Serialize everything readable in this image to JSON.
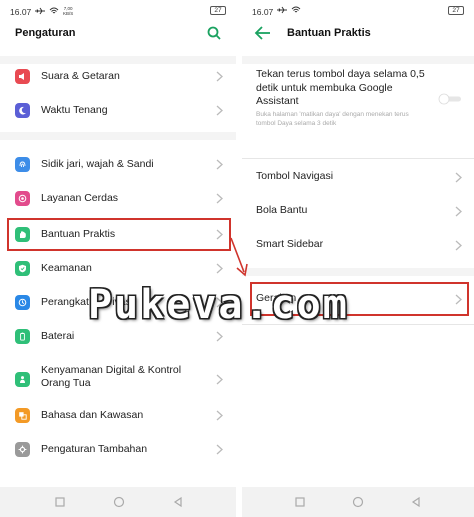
{
  "left": {
    "status": {
      "time": "16.07",
      "speed": "7,00\nKB/S",
      "battery": "27"
    },
    "title": "Pengaturan",
    "sections": [
      [
        {
          "id": "sound",
          "label": "Suara & Getaran",
          "icon": "speaker-icon",
          "color": "#e84a52"
        },
        {
          "id": "quiet",
          "label": "Waktu Tenang",
          "icon": "moon-icon",
          "color": "#5b5fd6"
        }
      ],
      [
        {
          "id": "fingerprint",
          "label": "Sidik jari, wajah & Sandi",
          "icon": "fingerprint-icon",
          "color": "#3d8de8"
        },
        {
          "id": "smart",
          "label": "Layanan Cerdas",
          "icon": "smart-services-icon",
          "color": "#e24b8c"
        },
        {
          "id": "assist",
          "label": "Bantuan Praktis",
          "icon": "hand-icon",
          "color": "#2fbf78"
        },
        {
          "id": "security",
          "label": "Keamanan",
          "icon": "shield-icon",
          "color": "#2fbf78"
        },
        {
          "id": "devices",
          "label": "Perangkat & Privasi",
          "icon": "devices-icon",
          "color": "#2a88e6"
        },
        {
          "id": "battery",
          "label": "Baterai",
          "icon": "battery-icon",
          "color": "#2fbf78"
        },
        {
          "id": "wellbeing",
          "label": "Kenyamanan Digital & Kontrol Orang Tua",
          "icon": "wellbeing-icon",
          "color": "#2fbf78"
        },
        {
          "id": "language",
          "label": "Bahasa dan Kawasan",
          "icon": "language-icon",
          "color": "#f39a26"
        },
        {
          "id": "additional",
          "label": "Pengaturan Tambahan",
          "icon": "gear-icon",
          "color": "#9a9a9a"
        }
      ]
    ]
  },
  "right": {
    "status": {
      "time": "16.07",
      "battery": "27"
    },
    "title": "Bantuan Praktis",
    "power_assistant": {
      "label": "Tekan terus tombol daya selama 0,5 detik untuk membuka Google Assistant",
      "sub": "Buka halaman 'matikan daya' dengan menekan terus tombol Daya selama 3 detik",
      "enabled": false
    },
    "items": [
      "Tombol Navigasi",
      "Bola Bantu",
      "Smart Sidebar"
    ],
    "gesture": "Gerakan"
  },
  "watermark": "Pukeva.com",
  "colors": {
    "accent": "#1aa260",
    "highlight": "#d0342c"
  }
}
